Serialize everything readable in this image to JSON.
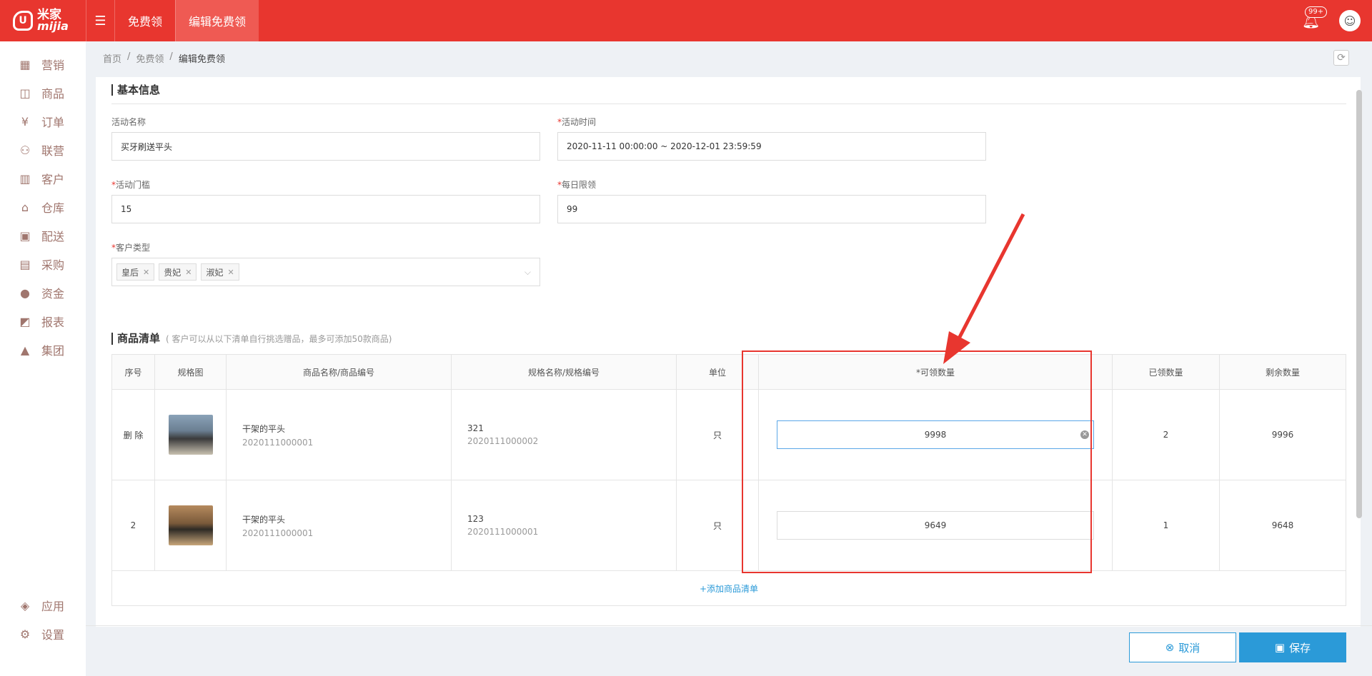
{
  "app": {
    "logo_cn": "米家",
    "logo_en": "mijia"
  },
  "header": {
    "tabs": [
      {
        "label": "免费领"
      },
      {
        "label": "编辑免费领"
      }
    ],
    "notification_count": "99+"
  },
  "sidebar": {
    "items": [
      {
        "label": "营销",
        "icon": "shop-icon"
      },
      {
        "label": "商品",
        "icon": "bag-icon"
      },
      {
        "label": "订单",
        "icon": "yen-icon"
      },
      {
        "label": "联营",
        "icon": "users-icon"
      },
      {
        "label": "客户",
        "icon": "building-icon"
      },
      {
        "label": "仓库",
        "icon": "warehouse-icon"
      },
      {
        "label": "配送",
        "icon": "truck-icon"
      },
      {
        "label": "采购",
        "icon": "basket-icon"
      },
      {
        "label": "资金",
        "icon": "moneybag-icon"
      },
      {
        "label": "报表",
        "icon": "chart-icon"
      },
      {
        "label": "集团",
        "icon": "group-icon"
      }
    ],
    "bottom_items": [
      {
        "label": "应用",
        "icon": "box-icon"
      },
      {
        "label": "设置",
        "icon": "gear-icon"
      }
    ]
  },
  "breadcrumb": {
    "home": "首页",
    "parent": "免费领",
    "current": "编辑免费领",
    "sep": "/"
  },
  "basic": {
    "title": "基本信息",
    "name_label": "活动名称",
    "name_value": "买牙刷送平头",
    "time_label": "活动时间",
    "time_value": "2020-11-11 00:00:00 ~ 2020-12-01 23:59:59",
    "threshold_label": "活动门槛",
    "threshold_value": "15",
    "daily_label": "每日限领",
    "daily_value": "99",
    "customer_label": "客户类型",
    "customer_tags": [
      "皇后",
      "贵妃",
      "淑妃"
    ],
    "required_mark": "*"
  },
  "goods": {
    "title": "商品清单",
    "hint": "( 客户可以从以下清单自行挑选赠品，最多可添加50款商品)",
    "columns": [
      "序号",
      "规格图",
      "商品名称/商品编号",
      "规格名称/规格编号",
      "单位",
      "*可领数量",
      "已领数量",
      "剩余数量"
    ],
    "rows": [
      {
        "index": "删 除",
        "name": "干架的平头",
        "code": "2020111000001",
        "spec_name": "321",
        "spec_code": "2020111000002",
        "unit": "只",
        "qty": "9998",
        "taken": "2",
        "remain": "9996"
      },
      {
        "index": "2",
        "name": "干架的平头",
        "code": "2020111000001",
        "spec_name": "123",
        "spec_code": "2020111000001",
        "unit": "只",
        "qty": "9649",
        "taken": "1",
        "remain": "9648"
      }
    ],
    "add_label": "+添加商品清单"
  },
  "footer": {
    "cancel_label": "取消",
    "save_label": "保存"
  },
  "colors": {
    "brand": "#e8362f",
    "accent": "#2b9ad8"
  }
}
